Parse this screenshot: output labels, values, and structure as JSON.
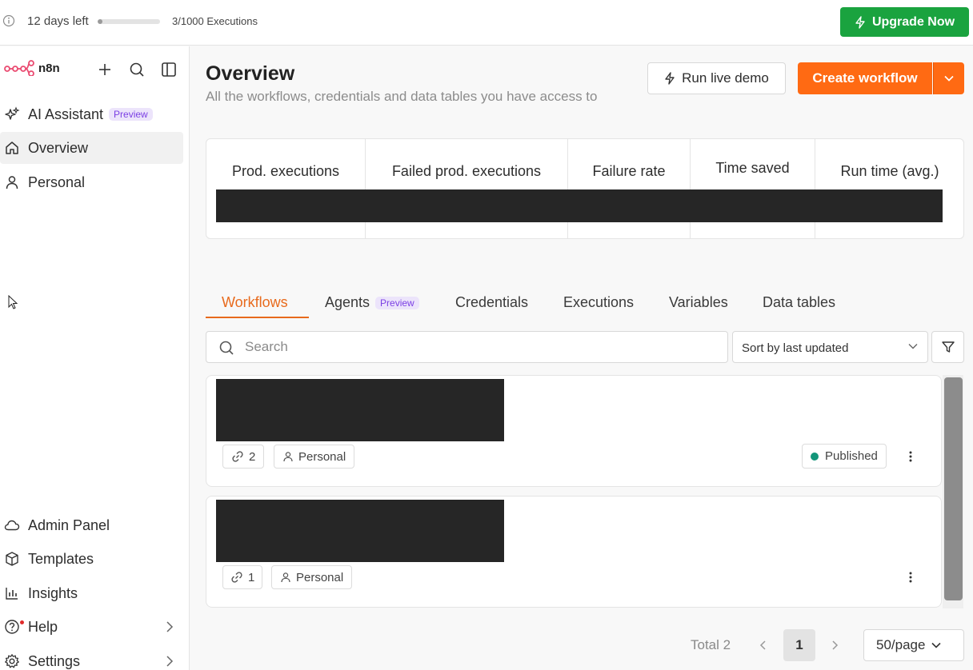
{
  "trial": {
    "days_left": "12 days left",
    "progress": 0.003,
    "executions": "3/1000 Executions",
    "upgrade_label": "Upgrade Now"
  },
  "brand": {
    "name": "n8n"
  },
  "sidebar": {
    "top_items": [
      {
        "label": "AI Assistant",
        "badge": "Preview",
        "icon": "sparkles-icon"
      },
      {
        "label": "Overview",
        "icon": "home-icon"
      },
      {
        "label": "Personal",
        "icon": "user-icon"
      }
    ],
    "bottom_items": [
      {
        "label": "Admin Panel",
        "icon": "cloud-icon"
      },
      {
        "label": "Templates",
        "icon": "box-icon"
      },
      {
        "label": "Insights",
        "icon": "bar-chart-icon"
      },
      {
        "label": "Help",
        "icon": "help-circle-icon"
      },
      {
        "label": "Settings",
        "icon": "gear-icon"
      }
    ]
  },
  "header": {
    "title": "Overview",
    "subtitle": "All the workflows, credentials and data tables you have access to",
    "demo_label": "Run live demo",
    "create_label": "Create workflow"
  },
  "stats": [
    {
      "label": "Prod. executions"
    },
    {
      "label": "Failed prod. executions"
    },
    {
      "label": "Failure rate"
    },
    {
      "label": "Time saved"
    },
    {
      "label": "Run time (avg.)"
    }
  ],
  "tabs": [
    {
      "label": "Workflows"
    },
    {
      "label": "Agents",
      "badge": "Preview"
    },
    {
      "label": "Credentials"
    },
    {
      "label": "Executions"
    },
    {
      "label": "Variables"
    },
    {
      "label": "Data tables"
    }
  ],
  "search": {
    "placeholder": "Search"
  },
  "sort": {
    "label": "Sort by last updated"
  },
  "workflows": [
    {
      "links": "2",
      "owner": "Personal",
      "status": "Published"
    },
    {
      "links": "1",
      "owner": "Personal"
    }
  ],
  "pagination": {
    "total": "Total 2",
    "current_page": "1",
    "per_page": "50/page"
  },
  "colors": {
    "accent": "#ff6a13",
    "upgrade": "#1aa33f",
    "published": "#13967a",
    "preview_badge": "#7b3fe4"
  }
}
